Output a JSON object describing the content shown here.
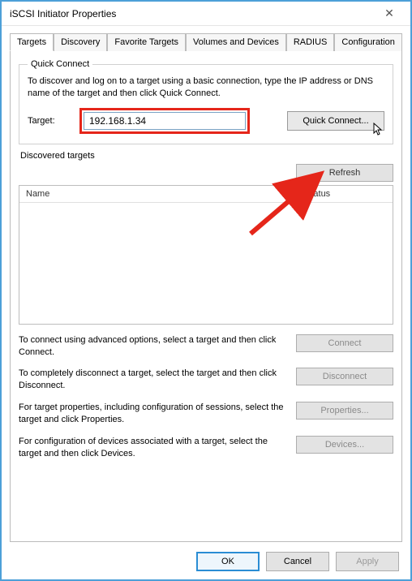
{
  "window": {
    "title": "iSCSI Initiator Properties"
  },
  "tabs": {
    "t0": "Targets",
    "t1": "Discovery",
    "t2": "Favorite Targets",
    "t3": "Volumes and Devices",
    "t4": "RADIUS",
    "t5": "Configuration"
  },
  "quick_connect": {
    "legend": "Quick Connect",
    "help": "To discover and log on to a target using a basic connection, type the IP address or DNS name of the target and then click Quick Connect.",
    "target_label": "Target:",
    "target_value": "192.168.1.34",
    "button": "Quick Connect..."
  },
  "discovered": {
    "label": "Discovered targets",
    "refresh": "Refresh",
    "col_name": "Name",
    "col_status": "Status"
  },
  "actions": {
    "connect_text": "To connect using advanced options, select a target and then click Connect.",
    "connect_btn": "Connect",
    "disconnect_text": "To completely disconnect a target, select the target and then click Disconnect.",
    "disconnect_btn": "Disconnect",
    "props_text": "For target properties, including configuration of sessions, select the target and click Properties.",
    "props_btn": "Properties...",
    "devices_text": "For configuration of devices associated with a target, select the target and then click Devices.",
    "devices_btn": "Devices..."
  },
  "dialog": {
    "ok": "OK",
    "cancel": "Cancel",
    "apply": "Apply"
  }
}
